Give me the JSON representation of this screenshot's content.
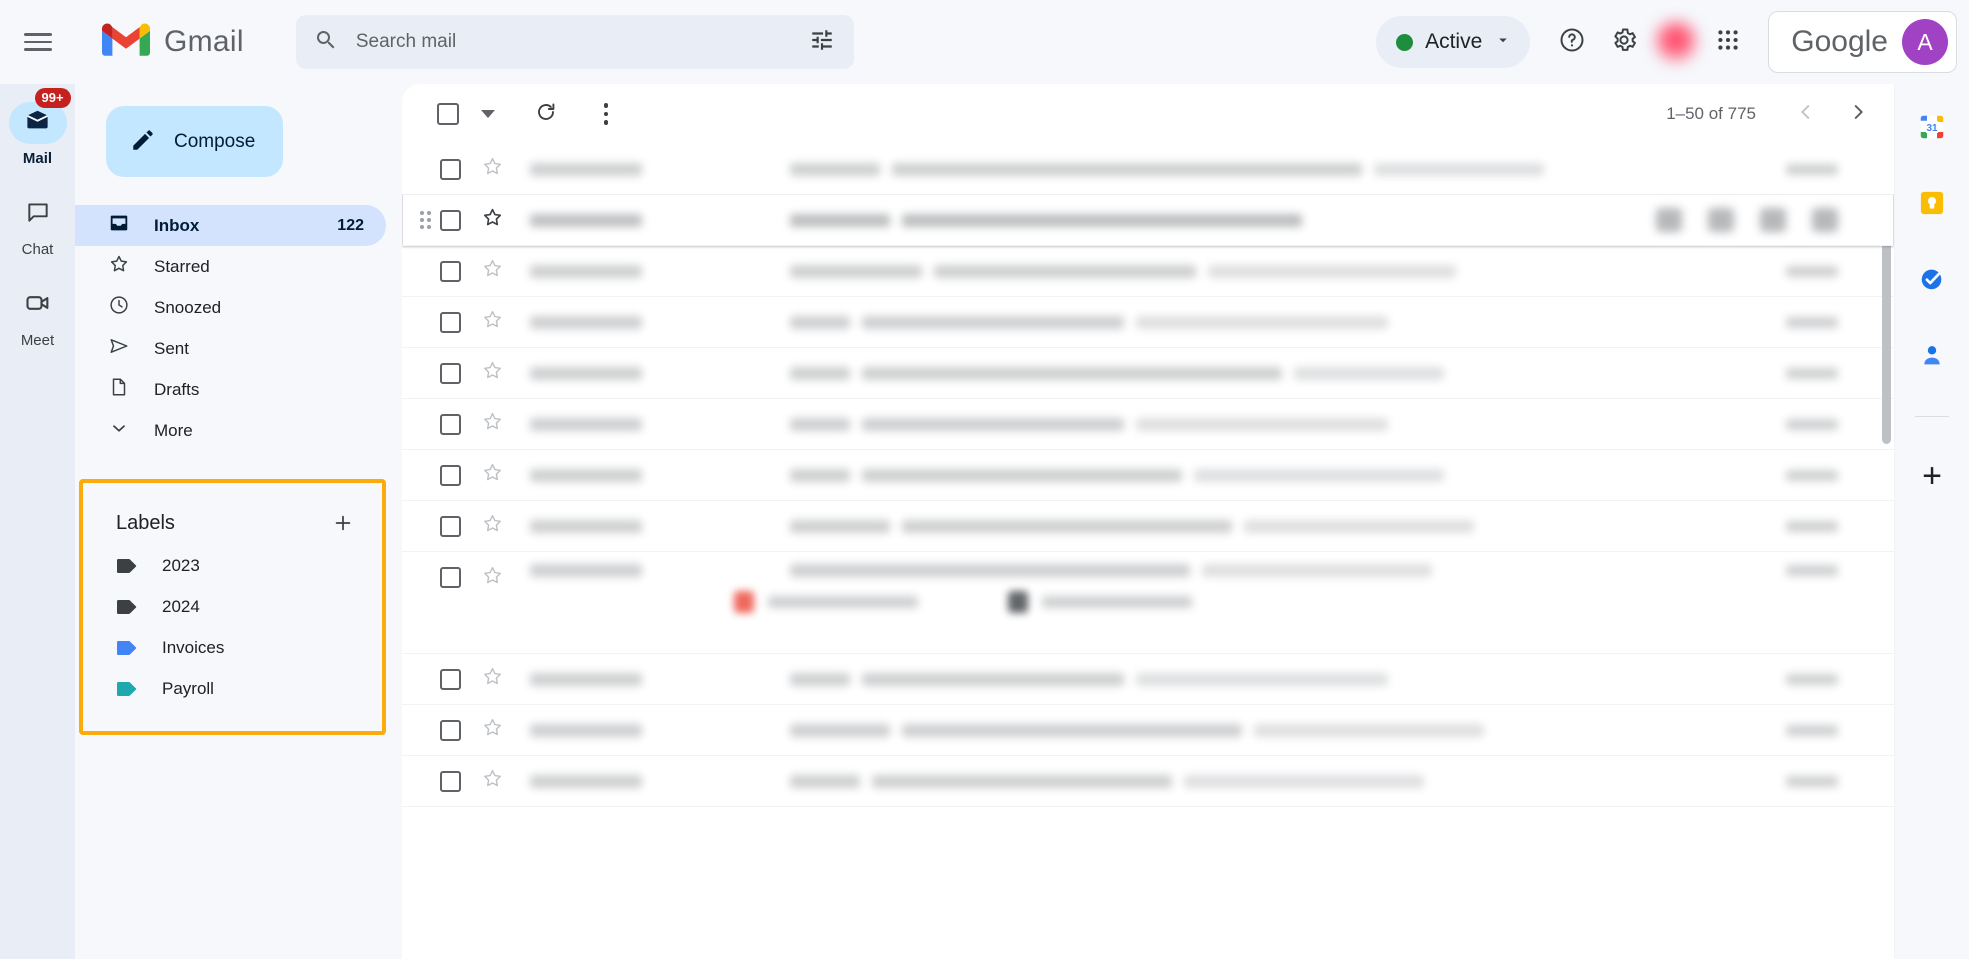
{
  "header": {
    "menu_icon": "hamburger-menu-icon",
    "brand": {
      "logo_icon": "gmail-logo-icon",
      "name": "Gmail"
    },
    "search": {
      "icon": "search-icon",
      "placeholder": "Search mail",
      "value": "",
      "options_icon": "search-options-icon"
    },
    "status": {
      "label": "Active",
      "dot_color": "#1e8e3e",
      "chevron_icon": "chevron-down-icon"
    },
    "help_icon": "help-icon",
    "settings_icon": "gear-icon",
    "notification_avatar": "blurred-profile-icon",
    "apps_icon": "google-apps-grid-icon",
    "account": {
      "brand": "Google",
      "avatar_initial": "A",
      "avatar_color": "#a142c4"
    }
  },
  "app_rail": [
    {
      "label": "Mail",
      "icon": "mail-icon",
      "badge": "99+",
      "active": true
    },
    {
      "label": "Chat",
      "icon": "chat-icon",
      "badge": "",
      "active": false
    },
    {
      "label": "Meet",
      "icon": "meet-camera-icon",
      "badge": "",
      "active": false
    }
  ],
  "sidebar": {
    "compose": {
      "label": "Compose",
      "icon": "pencil-icon"
    },
    "items": [
      {
        "label": "Inbox",
        "icon": "inbox-icon",
        "count": "122",
        "selected": true
      },
      {
        "label": "Starred",
        "icon": "star-icon",
        "count": "",
        "selected": false
      },
      {
        "label": "Snoozed",
        "icon": "clock-icon",
        "count": "",
        "selected": false
      },
      {
        "label": "Sent",
        "icon": "send-icon",
        "count": "",
        "selected": false
      },
      {
        "label": "Drafts",
        "icon": "document-icon",
        "count": "",
        "selected": false
      },
      {
        "label": "More",
        "icon": "chevron-down-icon",
        "count": "",
        "selected": false
      }
    ],
    "labels_section": {
      "title": "Labels",
      "add_icon": "plus-icon",
      "highlight_color": "#fbab0b",
      "items": [
        {
          "label": "2023",
          "icon": "label-tag-icon",
          "color": "#3c4043"
        },
        {
          "label": "2024",
          "icon": "label-tag-icon",
          "color": "#3c4043"
        },
        {
          "label": "Invoices",
          "icon": "label-tag-icon",
          "color": "#4285f4"
        },
        {
          "label": "Payroll",
          "icon": "label-tag-icon",
          "color": "#1fa9ad"
        }
      ]
    }
  },
  "list": {
    "toolbar": {
      "select_all_icon": "checkbox-icon",
      "select_caret_icon": "chevron-down-icon",
      "refresh_icon": "refresh-icon",
      "more_icon": "kebab-menu-icon"
    },
    "pagination": {
      "range": "1–50 of 775",
      "prev_icon": "chevron-left-icon",
      "next_icon": "chevron-right-icon"
    },
    "rows": [
      {
        "kind": "normal",
        "redacted": true
      },
      {
        "kind": "hovered",
        "redacted": true
      },
      {
        "kind": "normal",
        "redacted": true
      },
      {
        "kind": "normal",
        "redacted": true
      },
      {
        "kind": "normal",
        "redacted": true
      },
      {
        "kind": "normal",
        "redacted": true
      },
      {
        "kind": "normal",
        "redacted": true
      },
      {
        "kind": "normal",
        "redacted": true
      },
      {
        "kind": "attachments",
        "redacted": true
      },
      {
        "kind": "normal",
        "redacted": true
      },
      {
        "kind": "normal",
        "redacted": true
      }
    ]
  },
  "side_rail": [
    {
      "icon": "google-calendar-icon",
      "label": "31"
    },
    {
      "icon": "google-keep-icon",
      "label": ""
    },
    {
      "icon": "google-tasks-icon",
      "label": ""
    },
    {
      "icon": "google-contacts-icon",
      "label": ""
    }
  ],
  "side_rail_add": {
    "icon": "plus-icon"
  }
}
